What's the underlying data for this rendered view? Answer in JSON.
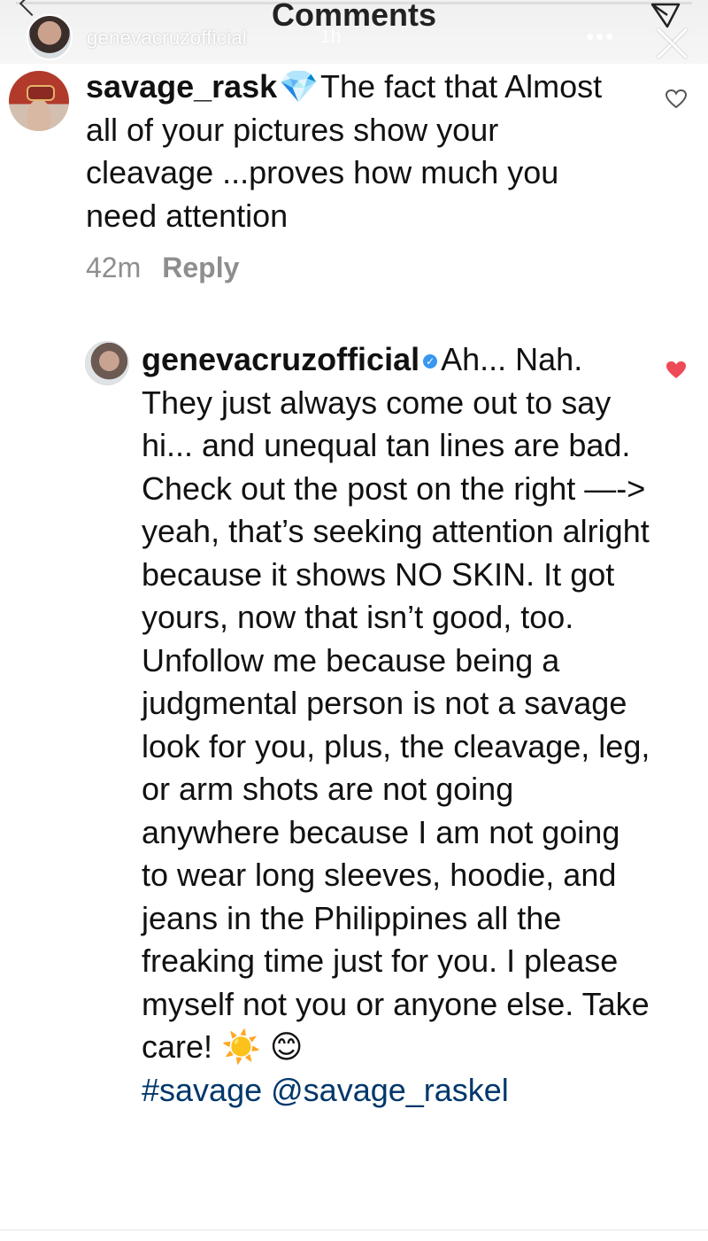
{
  "header": {
    "title": "Comments",
    "story_username": "genevacruzofficial",
    "story_time": "1h",
    "more_label": "•••"
  },
  "comments": [
    {
      "username": "savage_rask",
      "badge_emoji": "💎",
      "text": "The fact that Almost all of your pictures show your cleavage ...proves how much you need attention",
      "time": "42m",
      "reply_label": "Reply",
      "liked": false
    },
    {
      "username": "genevacruzofficial",
      "verified": true,
      "text": "Ah... Nah. They just always come out to say hi... and unequal tan lines are bad. Check out the post on the right —-> yeah, that’s seeking attention alright because it shows NO SKIN. It got yours, now that isn’t good, too. Unfollow me because being a judgmental person is not a savage look for you, plus, the cleavage, leg, or arm shots are not going anywhere because I am not going to wear long sleeves, hoodie, and jeans in the Philippines all the freaking time just for you. I please myself not you or anyone else. Take care! ☀️ 😊",
      "hashtag": "#savage",
      "mention": "@savage_raskel",
      "liked": true
    }
  ],
  "icons": {
    "like": "heart-icon",
    "liked": "heart-filled-icon",
    "send": "send-icon",
    "close": "close-icon",
    "back": "chevron-left-icon"
  },
  "colors": {
    "liked_heart": "#ed4956",
    "hashtag": "#00376b",
    "meta": "#8e8e8e",
    "verified": "#3897f0"
  }
}
